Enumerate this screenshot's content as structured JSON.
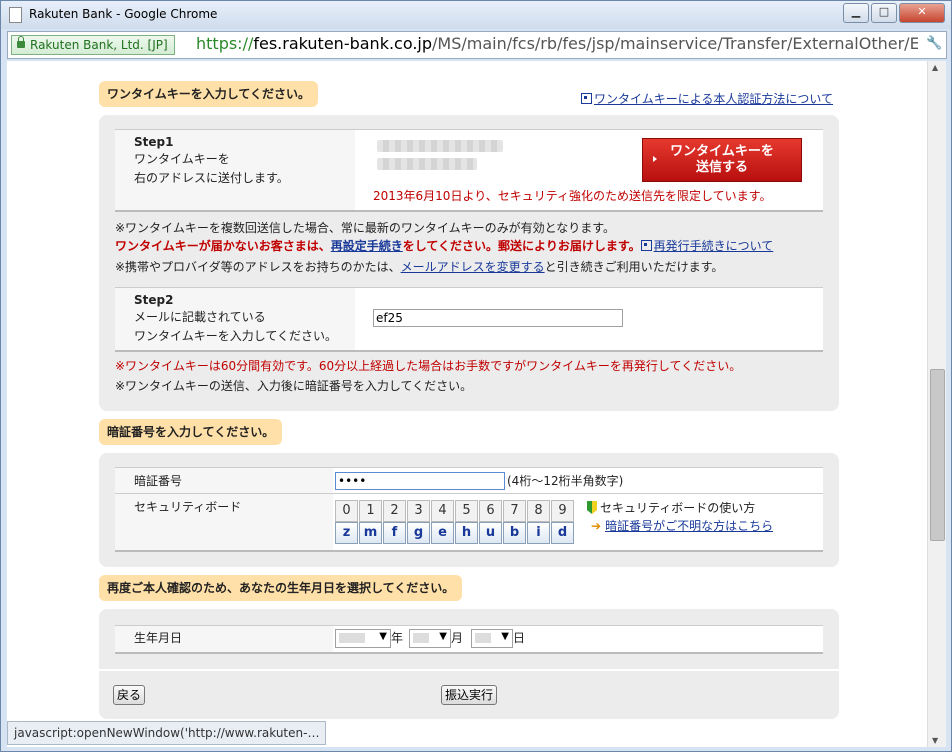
{
  "window": {
    "title": "Rakuten Bank - Google Chrome",
    "controls": {
      "minimize": "▁",
      "maximize": "□",
      "close": "✕"
    }
  },
  "addressbar": {
    "ev_label": "Rakuten Bank, Ltd. [JP]",
    "scheme": "https://",
    "host": "fes.rakuten-bank.co.jp",
    "path": "/MS/main/fcs/rb/fes/jsp/mainservice/Transfer/ExternalOther/E"
  },
  "section1": {
    "tab": "ワンタイムキーを入力してください。",
    "help_link": "ワンタイムキーによる本人認証方法について",
    "step1": {
      "title": "Step1",
      "line1": "ワンタイムキーを",
      "line2": "右のアドレスに送付します。",
      "send_line1": "ワンタイムキーを",
      "send_line2": "送信する",
      "notice": "2013年6月10日より、セキュリティ強化のため送信先を限定しています。"
    },
    "notes": {
      "n1": "※ワンタイムキーを複数回送信した場合、常に最新のワンタイムキーのみが有効となります。",
      "n2_a": "ワンタイムキーが届かないお客さまは、",
      "n2_link": "再設定手続き",
      "n2_b": "をしてください。郵送によりお届けします。",
      "n2_help": "再発行手続きについて",
      "n3_a": "※携帯やプロバイダ等のアドレスをお持ちのかたは、",
      "n3_link": "メールアドレスを変更する",
      "n3_b": "と引き続きご利用いただけます。"
    },
    "step2": {
      "title": "Step2",
      "line1": "メールに記載されている",
      "line2": "ワンタイムキーを入力してください。",
      "value": "ef25"
    },
    "notes2": {
      "n1": "※ワンタイムキーは60分間有効です。60分以上経過した場合はお手数ですがワンタイムキーを再発行してください。",
      "n2": "※ワンタイムキーの送信、入力後に暗証番号を入力してください。"
    }
  },
  "section2": {
    "tab": "暗証番号を入力してください。",
    "pin_label": "暗証番号",
    "pin_value": "••••",
    "pin_hint": "(4桁〜12桁半角数字)",
    "board_label": "セキュリティボード",
    "digits": [
      "0",
      "1",
      "2",
      "3",
      "4",
      "5",
      "6",
      "7",
      "8",
      "9"
    ],
    "letters": [
      "z",
      "m",
      "f",
      "g",
      "e",
      "h",
      "u",
      "b",
      "i",
      "d"
    ],
    "board_help": "セキュリティボードの使い方",
    "forgot_link": "暗証番号がご不明な方はこちら"
  },
  "section3": {
    "tab": "再度ご本人確認のため、あなたの生年月日を選択してください。",
    "label": "生年月日",
    "year_unit": "年",
    "month_unit": "月",
    "day_unit": "日"
  },
  "actions": {
    "back": "戻る",
    "execute": "振込実行"
  },
  "statusbar": "javascript:openNewWindow('http://www.rakuten-…"
}
